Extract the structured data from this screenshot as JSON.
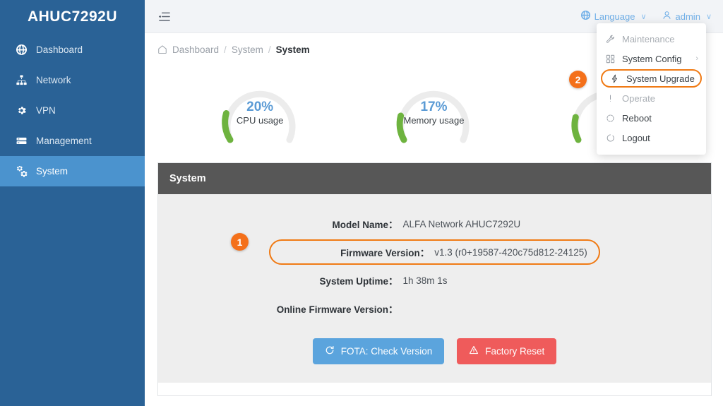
{
  "sidebar": {
    "brand": "AHUC7292U",
    "items": [
      {
        "label": "Dashboard",
        "icon": "globe-icon",
        "active": false
      },
      {
        "label": "Network",
        "icon": "sitemap-icon",
        "active": false
      },
      {
        "label": "VPN",
        "icon": "gear-icon",
        "active": false
      },
      {
        "label": "Management",
        "icon": "server-icon",
        "active": false
      },
      {
        "label": "System",
        "icon": "gears-icon",
        "active": true
      }
    ],
    "background": "#2a6296",
    "active_background": "#4b93ce"
  },
  "topbar": {
    "collapse_icon": "collapse-menu-icon",
    "language": {
      "label": "Language",
      "icon": "globe-icon",
      "caret": "∨"
    },
    "user": {
      "label": "admin",
      "icon": "user-icon",
      "caret": "∨"
    }
  },
  "breadcrumb": {
    "home_icon": "home-icon",
    "items": [
      "Dashboard",
      "System",
      "System"
    ],
    "separator": "/"
  },
  "gauges": [
    {
      "value": "20%",
      "label": "CPU usage",
      "percent": 20,
      "color": "#6eb33f"
    },
    {
      "value": "17%",
      "label": "Memory usage",
      "percent": 17,
      "color": "#6eb33f"
    },
    {
      "value": "",
      "label": "",
      "percent": 15,
      "color": "#6eb33f"
    }
  ],
  "panel": {
    "title": "System",
    "rows": [
      {
        "label": "Model Name：",
        "value": "ALFA Network AHUC7292U",
        "highlight": false
      },
      {
        "label": "Firmware Version：",
        "value": "v1.3 (r0+19587-420c75d812-24125)",
        "highlight": true
      },
      {
        "label": "System Uptime：",
        "value": "1h 38m 1s",
        "highlight": false
      },
      {
        "label": "Online Firmware Version：",
        "value": "",
        "highlight": false
      }
    ],
    "buttons": [
      {
        "label": "FOTA: Check Version",
        "icon": "refresh-icon",
        "style": "primary",
        "color": "#5ba4dd"
      },
      {
        "label": "Factory Reset",
        "icon": "warning-triangle-icon",
        "style": "danger",
        "color": "#ef5b5b"
      }
    ]
  },
  "dropdown": {
    "items": [
      {
        "label": "Maintenance",
        "icon": "wrench-icon",
        "type": "group",
        "arrow": ""
      },
      {
        "label": "System Config",
        "icon": "grid-icon",
        "type": "item",
        "arrow": "›"
      },
      {
        "label": "System Upgrade",
        "icon": "bolt-icon",
        "type": "selected",
        "arrow": ""
      },
      {
        "label": "Operate",
        "icon": "exclamation-icon",
        "type": "group",
        "arrow": ""
      },
      {
        "label": "Reboot",
        "icon": "refresh-icon",
        "type": "item",
        "arrow": ""
      },
      {
        "label": "Logout",
        "icon": "refresh-icon",
        "type": "item",
        "arrow": ""
      }
    ]
  },
  "annotations": [
    {
      "number": "1",
      "target": "firmware-version-row"
    },
    {
      "number": "2",
      "target": "menu-item-system-upgrade"
    }
  ]
}
